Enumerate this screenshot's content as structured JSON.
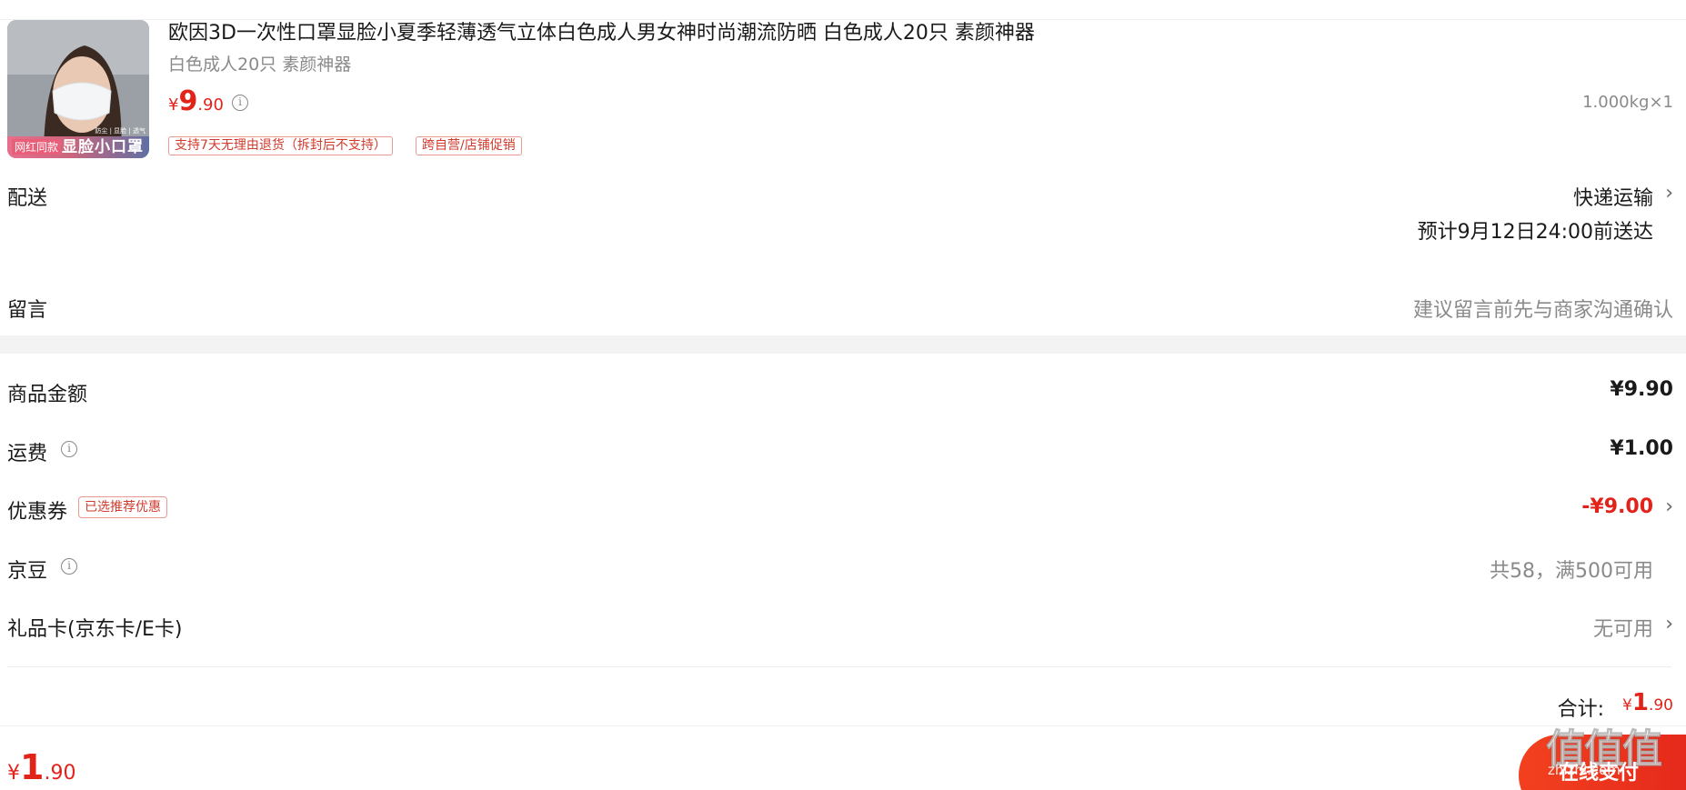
{
  "product": {
    "title": "欧因3D一次性口罩显脸小夏季轻薄透气立体白色成人男女神时尚潮流防晒 白色成人20只 素颜神器",
    "spec": "白色成人20只 素颜神器",
    "thumb_badge_left": "网红同款",
    "thumb_badge_right": "显脸小口罩",
    "thumb_badge_small": "防尘 | 显脸 | 透气",
    "price_yen": "¥",
    "price_int": "9",
    "price_dec": ".90",
    "weight": "1.000kg×1",
    "tags": [
      "支持7天无理由退货（拆封后不支持）",
      "跨自营/店铺促销"
    ]
  },
  "delivery": {
    "label": "配送",
    "method": "快递运输",
    "eta": "预计9月12日24:00前送达"
  },
  "message": {
    "label": "留言",
    "placeholder": "建议留言前先与商家沟通确认"
  },
  "summary": {
    "goods_label": "商品金额",
    "goods_value": "¥9.90",
    "shipping_label": "运费",
    "shipping_value": "¥1.00",
    "coupon_label": "优惠券",
    "coupon_tag": "已选推荐优惠",
    "coupon_value": "-¥9.00",
    "jingdou_label": "京豆",
    "jingdou_value": "共58，满500可用",
    "giftcard_label": "礼品卡(京东卡/E卡)",
    "giftcard_value": "无可用",
    "total_label": "合计:",
    "total_yen": "¥",
    "total_int": "1",
    "total_dec": ".90"
  },
  "footer": {
    "pay_yen": "¥",
    "pay_int": "1",
    "pay_dec": ".90",
    "pay_button": "在线支付",
    "watermark": "值值值",
    "watermark_url": "zhizhi.com"
  },
  "colors": {
    "accent_red": "#e2231a",
    "grey_text": "#8a8a8a",
    "band": "#f3f3f3"
  }
}
